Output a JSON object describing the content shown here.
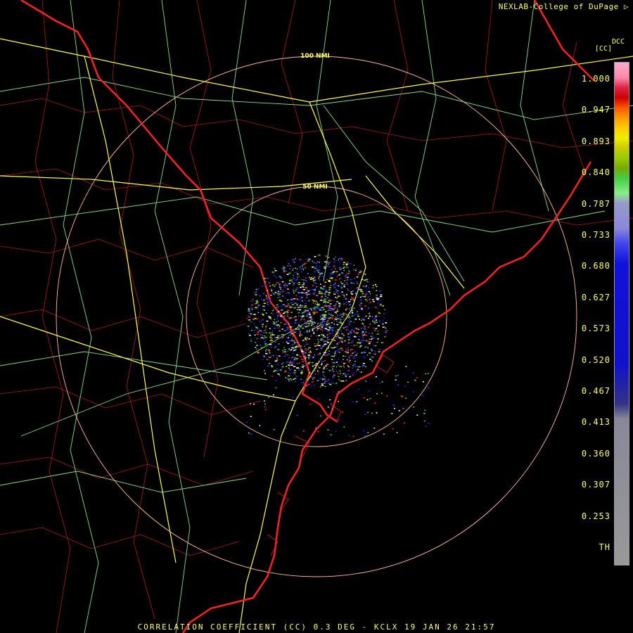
{
  "credit": "NEXLAB-College of DuPage",
  "credit_icon": "external-link-icon",
  "legend": {
    "title": "DCC",
    "unit": "[CC]",
    "ticks": [
      "1.000",
      "0.947",
      "0.893",
      "0.840",
      "0.787",
      "0.733",
      "0.680",
      "0.627",
      "0.573",
      "0.520",
      "0.467",
      "0.413",
      "0.360",
      "0.307",
      "0.253",
      "TH"
    ]
  },
  "rings": {
    "outer": "100 NMI",
    "inner": "50 NMI"
  },
  "footer": "CORRELATION COEFFICIENT (CC) 0.3 DEG - KCLX 19 JAN 26 21:57",
  "colors": {
    "coast": "#ff2222",
    "county": "#aa1a1a",
    "roads": "#88dd88",
    "interstate": "#ffff44",
    "rings": "#ffbb99",
    "text": "#ffff66"
  }
}
